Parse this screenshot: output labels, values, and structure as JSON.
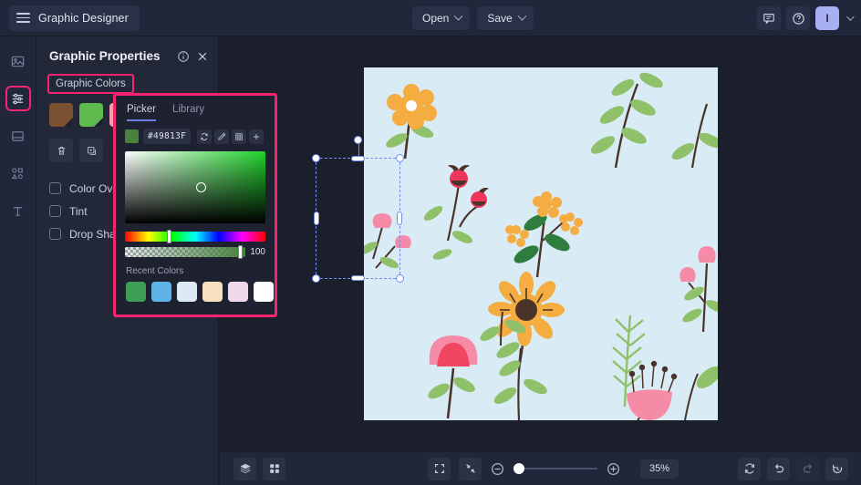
{
  "app": {
    "title": "Graphic Designer",
    "menu_icon": "hamburger-icon"
  },
  "topbar": {
    "open_label": "Open",
    "save_label": "Save",
    "comment_icon": "comment-icon",
    "help_icon": "help-icon",
    "avatar_initial": "I"
  },
  "rail": {
    "items": [
      {
        "name": "image-icon",
        "label": "Images",
        "active": false
      },
      {
        "name": "sliders-icon",
        "label": "Properties",
        "active": true
      },
      {
        "name": "layout-icon",
        "label": "Layout",
        "active": false
      },
      {
        "name": "shapes-icon",
        "label": "Shapes",
        "active": false
      },
      {
        "name": "text-icon",
        "label": "Text",
        "active": false
      }
    ],
    "highlight_color": "#f4246e"
  },
  "panel": {
    "title": "Graphic Properties",
    "info_icon": "info-icon",
    "close_icon": "close-icon",
    "section_label": "Graphic Colors",
    "section_highlight_color": "#f4246e",
    "swatches": [
      "#7a5130",
      "#5fbb4e",
      "#f4a0ad"
    ],
    "tools": [
      {
        "name": "delete-icon",
        "label": "Delete"
      },
      {
        "name": "duplicate-icon",
        "label": "Duplicate"
      }
    ],
    "effects": [
      {
        "label": "Color Overlay",
        "checked": false
      },
      {
        "label": "Tint",
        "checked": false
      },
      {
        "label": "Drop Shadow",
        "checked": false
      }
    ]
  },
  "picker": {
    "border_color": "#f4246e",
    "tabs": [
      {
        "label": "Picker",
        "active": true
      },
      {
        "label": "Library",
        "active": false
      }
    ],
    "hex_value": "#49813F",
    "swatch_color": "#49813F",
    "actions": [
      {
        "name": "refresh-icon",
        "label": "Reset"
      },
      {
        "name": "eyedropper-icon",
        "label": "Pick color"
      },
      {
        "name": "palette-grid-icon",
        "label": "Palette"
      },
      {
        "name": "plus-icon",
        "label": "Add color"
      }
    ],
    "alpha_value": "100",
    "hue_position_pct": 32,
    "recent_title": "Recent Colors",
    "recent_colors": [
      "#3e9e53",
      "#5fb3e4",
      "#dbeaf3",
      "#f7e0bd",
      "#efdaed",
      "#ffffff"
    ]
  },
  "canvas": {
    "artboard_color": "#d9ecf6",
    "selection": {
      "name": "selection-box",
      "handles": [
        "top-left",
        "top-right",
        "bottom-left",
        "bottom-right",
        "left-mid",
        "right-mid",
        "bottom-mid",
        "rotate"
      ]
    }
  },
  "bottombar": {
    "layers_icon": "layers-icon",
    "grid_icon": "grid-icon",
    "fullscreen_icon": "fullscreen-icon",
    "fit_screen_icon": "fit-screen-icon",
    "zoom_out_icon": "zoom-out-icon",
    "zoom_in_icon": "zoom-in-icon",
    "zoom_level": "35%",
    "zoom_slider_pct": 0,
    "history_actions": [
      {
        "name": "reset-icon",
        "label": "Reset",
        "disabled": false
      },
      {
        "name": "undo-icon",
        "label": "Undo",
        "disabled": false
      },
      {
        "name": "redo-icon",
        "label": "Redo",
        "disabled": true
      },
      {
        "name": "history-icon",
        "label": "History",
        "disabled": false
      }
    ]
  }
}
